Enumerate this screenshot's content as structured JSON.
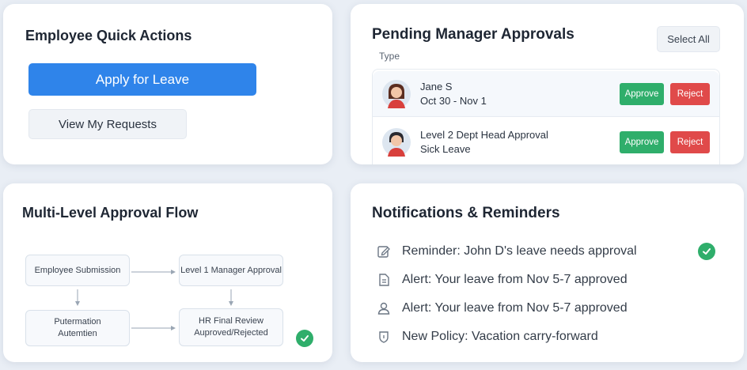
{
  "quick_actions": {
    "title": "Employee Quick Actions",
    "apply_label": "Apply for Leave",
    "view_label": "View My Requests"
  },
  "approvals": {
    "title": "Pending Manager Approvals",
    "select_all": "Select All",
    "col_type": "Type",
    "rows": [
      {
        "line1": "Jane S",
        "line2": "Oct 30 - Nov 1",
        "approve": "Approve",
        "reject": "Reject"
      },
      {
        "line1": "Level 2 Dept Head Approval",
        "line2": "Sick Leave",
        "approve": "Approve",
        "reject": "Reject"
      }
    ]
  },
  "flow": {
    "title": "Multi-Level Approval Flow",
    "steps": [
      {
        "line1": "Employee Submission",
        "line2": ""
      },
      {
        "line1": "Level 1 Manager Approval",
        "line2": ""
      },
      {
        "line1": "Putermation",
        "line2": "Autemtien"
      },
      {
        "line1": "HR Final Review",
        "line2": "Auproved/Rejected"
      }
    ]
  },
  "notifications": {
    "title": "Notifications & Reminders",
    "items": [
      {
        "text": "Reminder: John D's leave needs approval",
        "icon": "edit-icon"
      },
      {
        "text": "Alert: Your leave from Nov 5-7   approved",
        "icon": "document-icon"
      },
      {
        "text": "Alert: Your leave from Nov 5-7   approved",
        "icon": "user-icon"
      },
      {
        "text": "New Policy: Vacation carry-forward",
        "icon": "shield-icon"
      }
    ]
  },
  "colors": {
    "primary": "#2f84ea",
    "approve": "#2fae6b",
    "reject": "#e04a4a",
    "check": "#2fae6b"
  }
}
